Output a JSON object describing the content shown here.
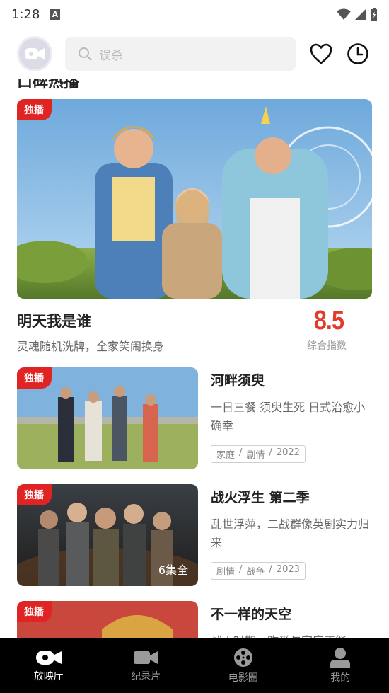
{
  "status": {
    "time": "1:28",
    "notif_icon": "A"
  },
  "search": {
    "placeholder": "误杀"
  },
  "section": {
    "title": "口碑热播"
  },
  "hero": {
    "badge": "独播",
    "title": "明天我是谁",
    "desc": "灵魂随机洗牌，全家笑闹换身",
    "score": "8.5",
    "score_label": "综合指数"
  },
  "cards": [
    {
      "badge": "独播",
      "title": "河畔须臾",
      "desc": "一日三餐 须臾生死 日式治愈小确幸",
      "tags": [
        "家庭",
        "/",
        "剧情",
        "/",
        "2022"
      ],
      "episodes": ""
    },
    {
      "badge": "独播",
      "title": "战火浮生 第二季",
      "desc": "乱世浮萍，二战群像英剧实力归来",
      "tags": [
        "剧情",
        "/",
        "战争",
        "/",
        "2023"
      ],
      "episodes": "6集全"
    },
    {
      "badge": "独播",
      "title": "不一样的天空",
      "desc": "战火时期，昨爱与家庭不能",
      "tags": [],
      "episodes": ""
    }
  ],
  "tabs": [
    {
      "label": "放映厅",
      "icon": "cinema-icon",
      "active": true
    },
    {
      "label": "纪录片",
      "icon": "video-camera-icon",
      "active": false
    },
    {
      "label": "电影圈",
      "icon": "film-reel-icon",
      "active": false
    },
    {
      "label": "我的",
      "icon": "person-icon",
      "active": false
    }
  ],
  "colors": {
    "accent": "#e02424",
    "score": "#e23a2c",
    "tab_bg": "#000000"
  }
}
